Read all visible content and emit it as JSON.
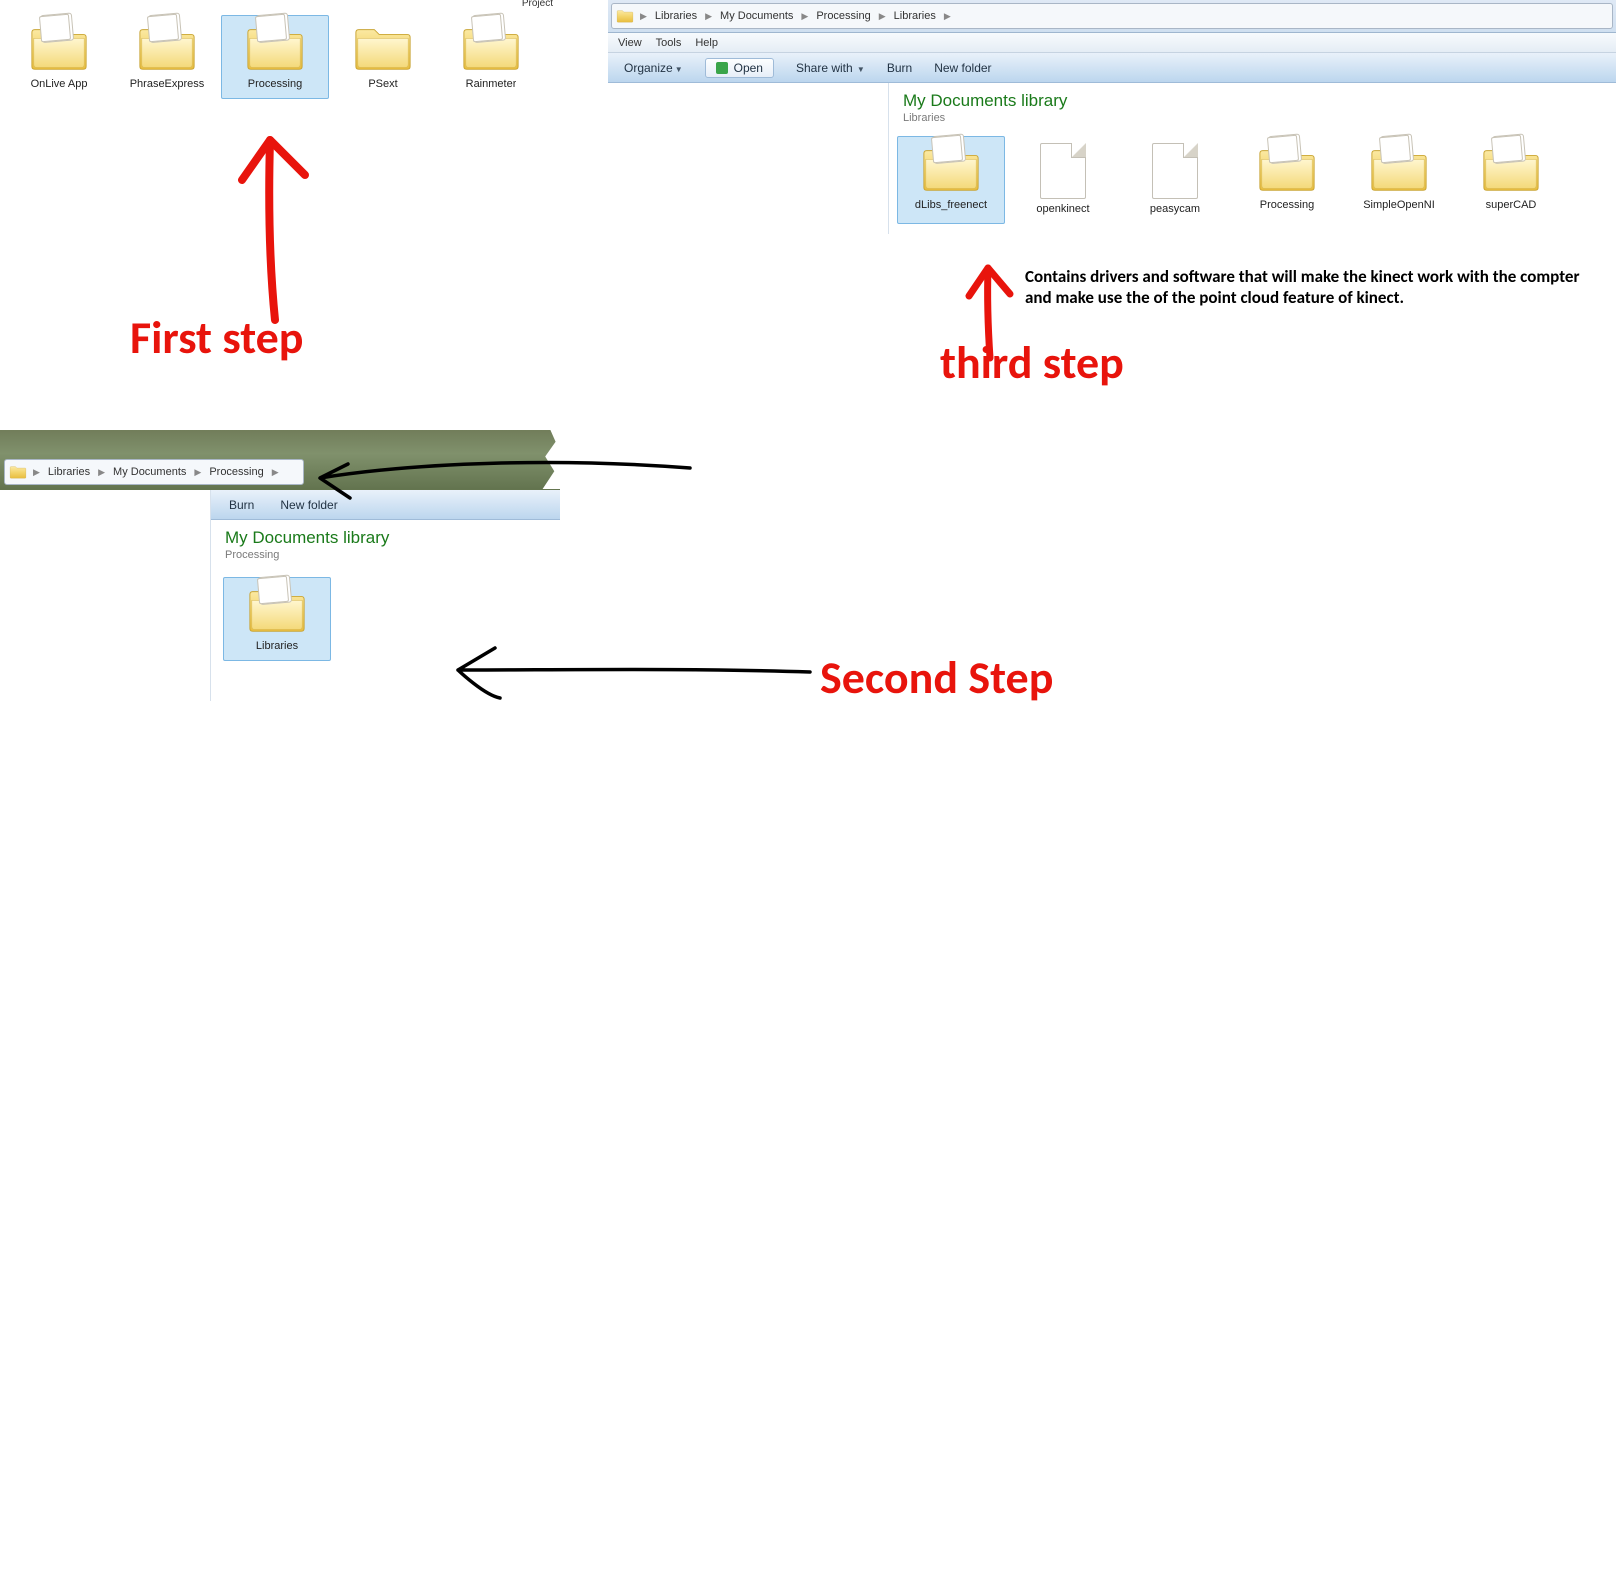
{
  "panel1": {
    "partial_label_top": "Project",
    "folders": [
      {
        "label": "OnLive App",
        "type": "folder-papers"
      },
      {
        "label": "PhraseExpress",
        "type": "folder-papers"
      },
      {
        "label": "Processing",
        "type": "folder-papers",
        "selected": true
      },
      {
        "label": "PSext",
        "type": "folder"
      },
      {
        "label": "Rainmeter",
        "type": "folder-papers"
      }
    ]
  },
  "panel3": {
    "breadcrumb": [
      "Libraries",
      "My Documents",
      "Processing",
      "Libraries"
    ],
    "menu": [
      "View",
      "Tools",
      "Help"
    ],
    "toolbar": {
      "organize": "Organize",
      "open": "Open",
      "share": "Share with",
      "burn": "Burn",
      "newfolder": "New folder"
    },
    "lib_title": "My Documents library",
    "lib_sub": "Libraries",
    "folders": [
      {
        "label": "dLibs_freenect",
        "type": "folder-papers",
        "selected": true
      },
      {
        "label": "openkinect",
        "type": "file"
      },
      {
        "label": "peasycam",
        "type": "file"
      },
      {
        "label": "Processing",
        "type": "folder-papers"
      },
      {
        "label": "SimpleOpenNI",
        "type": "folder-papers"
      },
      {
        "label": "superCAD",
        "type": "folder-papers"
      }
    ]
  },
  "panel2": {
    "breadcrumb": [
      "Libraries",
      "My Documents",
      "Processing"
    ],
    "toolbar": {
      "burn": "Burn",
      "newfolder": "New folder"
    },
    "lib_title": "My Documents library",
    "lib_sub": "Processing",
    "folders": [
      {
        "label": "Libraries",
        "type": "folder-papers",
        "selected": true
      }
    ]
  },
  "annotations": {
    "first": "First step",
    "second": "Second Step",
    "third": "third step",
    "desc": "Contains drivers and software that will make the kinect work with the compter and make use the of the point cloud feature of kinect."
  }
}
